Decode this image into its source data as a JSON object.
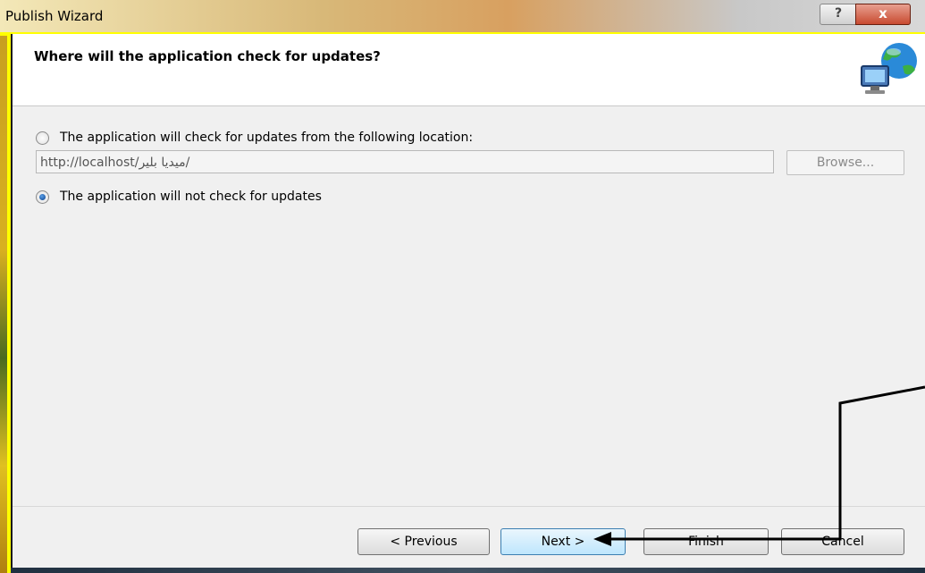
{
  "window": {
    "title": "Publish Wizard",
    "help_label": "?",
    "close_label": "x"
  },
  "header": {
    "title": "Where will the application check for updates?",
    "icon": "globe-network-icon"
  },
  "options": {
    "check_location_label": "The application will check for updates from the following location:",
    "check_location_selected": false,
    "url_value": "http://localhost/ميديا بلير/",
    "browse_label": "Browse...",
    "no_check_label": "The application will not check for updates",
    "no_check_selected": true
  },
  "footer": {
    "previous_label": "< Previous",
    "next_label": "Next >",
    "finish_label": "Finish",
    "cancel_label": "Cancel"
  },
  "colors": {
    "background_highlight": "#ffff00",
    "annotation": "#000000"
  }
}
